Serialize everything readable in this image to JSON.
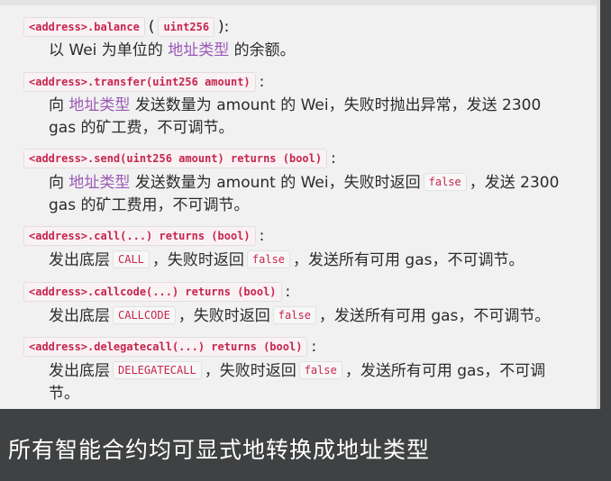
{
  "entries": [
    {
      "signature": "<address>.balance",
      "type_paren_open": "(",
      "type_code": "uint256",
      "type_paren_close": "):",
      "desc_1": "以 Wei 为单位的",
      "desc_link": "地址类型",
      "desc_2": "的余额。"
    },
    {
      "signature": "<address>.transfer(uint256 amount)",
      "colon": ":",
      "desc_1": "向",
      "desc_link": "地址类型",
      "desc_2": "发送数量为 amount 的 Wei，失败时抛出异常，发送 2300",
      "desc_3": "gas 的矿工费，不可调节。"
    },
    {
      "signature": "<address>.send(uint256 amount) returns (bool)",
      "colon": ":",
      "desc_1": "向",
      "desc_link": "地址类型",
      "desc_2": "发送数量为 amount 的 Wei，失败时返回",
      "desc_code": "false",
      "desc_3": "，发送 2300",
      "desc_4": "gas 的矿工费用，不可调节。"
    },
    {
      "signature": "<address>.call(...) returns (bool)",
      "colon": ":",
      "desc_1": "发出底层",
      "desc_code_1": "CALL",
      "desc_2": "，失败时返回",
      "desc_code_2": "false",
      "desc_3": "，发送所有可用 gas，不可调节。"
    },
    {
      "signature": "<address>.callcode(...) returns (bool)",
      "colon": ":",
      "desc_1": "发出底层",
      "desc_code_1": "CALLCODE",
      "desc_2": "，失败时返回",
      "desc_code_2": "false",
      "desc_3": "，发送所有可用 gas，不可调节。"
    },
    {
      "signature": "<address>.delegatecall(...) returns (bool)",
      "colon": ":",
      "desc_1": "发出底层",
      "desc_code_1": "DELEGATECALL",
      "desc_2": "，失败时返回",
      "desc_code_2": "false",
      "desc_3": "，发送所有可用 gas，不可调",
      "desc_4": "节。"
    }
  ],
  "footer": {
    "text": "所有智能合约均可显式地转换成地址类型"
  },
  "colors": {
    "code_text": "#c7254e",
    "link": "#9b59b6",
    "page_bg": "#f1f1f1",
    "footer_bg": "#3f4142"
  }
}
